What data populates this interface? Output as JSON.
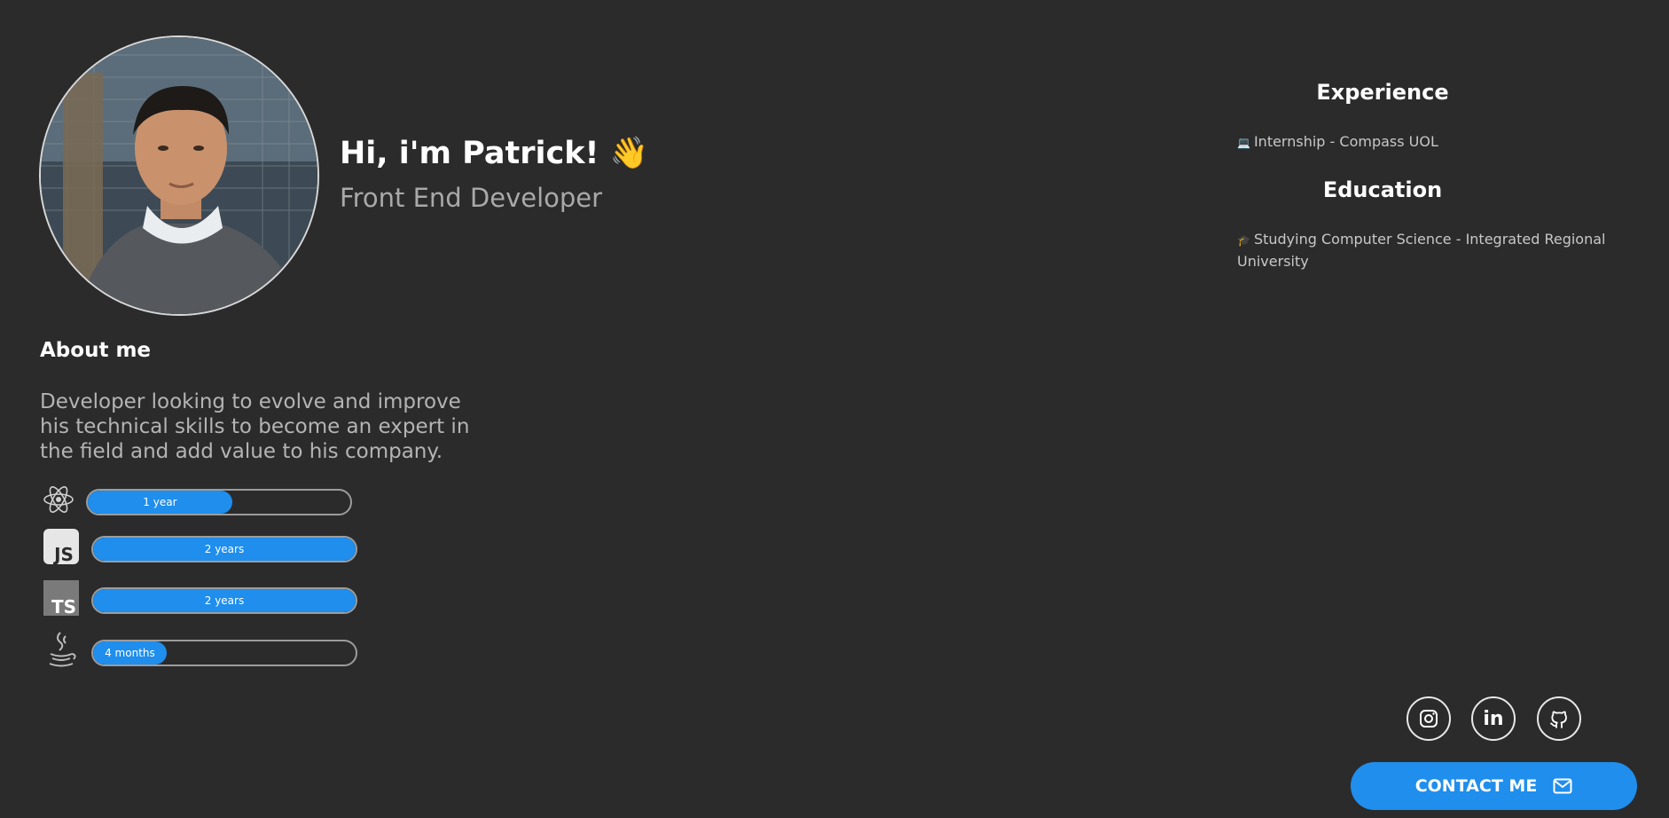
{
  "profile": {
    "greeting": "Hi, i'm Patrick!",
    "wave_emoji": "👋",
    "role": "Front End Developer",
    "avatar_alt": "profile-photo"
  },
  "about": {
    "title": "About me",
    "text": "Developer looking to evolve and improve his technical skills to become an expert in the field and add value to his company."
  },
  "skills": [
    {
      "icon": "react-icon",
      "label": "1 year",
      "fill": 0.55
    },
    {
      "icon": "javascript-icon",
      "icon_text": "JS",
      "label": "2 years",
      "fill": 1.0
    },
    {
      "icon": "typescript-icon",
      "icon_text": "TS",
      "label": "2 years",
      "fill": 1.0
    },
    {
      "icon": "java-icon",
      "label": "4 months",
      "fill": 0.28
    }
  ],
  "experience": {
    "title": "Experience",
    "emoji": "💻",
    "item": "Internship - Compass UOL"
  },
  "education": {
    "title": "Education",
    "emoji": "🎓",
    "item": "Studying Computer Science - Integrated Regional University"
  },
  "social": [
    {
      "icon": "instagram-icon"
    },
    {
      "icon": "linkedin-icon",
      "text": "in"
    },
    {
      "icon": "github-icon"
    }
  ],
  "contact": {
    "label": "CONTACT ME",
    "icon": "mail-icon"
  },
  "colors": {
    "background": "#2b2b2b",
    "accent": "#1f8eed",
    "muted_text": "#a9a9a9"
  }
}
